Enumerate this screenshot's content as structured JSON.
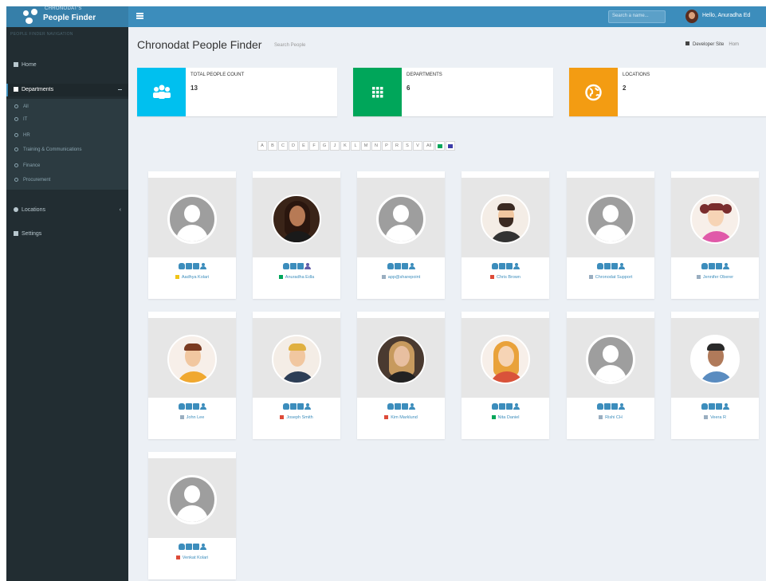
{
  "app": {
    "logo_small": "CHRONODAT'S",
    "logo_big": "People Finder"
  },
  "header": {
    "search_placeholder": "Search a name...",
    "user_name": "Hello, Anuradha Ed"
  },
  "sidebar": {
    "header": "PEOPLE FINDER NAVIGATION",
    "items": [
      {
        "label": "Home",
        "icon": "home-icon"
      },
      {
        "label": "Departments",
        "icon": "grid-icon"
      },
      {
        "label": "Locations",
        "icon": "globe-icon"
      },
      {
        "label": "Settings",
        "icon": "gears-icon"
      }
    ],
    "departments": [
      "All",
      "IT",
      "HR",
      "Training & Communications",
      "Finance",
      "Procurement"
    ]
  },
  "page": {
    "title": "Chronodat People Finder",
    "subtitle": "Search People",
    "breadcrumb": [
      "Developer Site",
      "Hom"
    ]
  },
  "stats": [
    {
      "label": "TOTAL PEOPLE COUNT",
      "value": "13",
      "color": "#00c0ef",
      "icon": "users-icon"
    },
    {
      "label": "DEPARTMENTS",
      "value": "6",
      "color": "#00a65a",
      "icon": "apps-grid-icon"
    },
    {
      "label": "LOCATIONS",
      "value": "2",
      "color": "#f39c12",
      "icon": "globe-icon"
    }
  ],
  "alphabet": [
    "A",
    "B",
    "C",
    "D",
    "E",
    "F",
    "G",
    "J",
    "K",
    "L",
    "M",
    "N",
    "P",
    "R",
    "S",
    "V",
    "All"
  ],
  "view_toggles": [
    {
      "icon": "card-view-icon",
      "color": "#00a65a"
    },
    {
      "icon": "list-view-icon",
      "color": "#3c3ca8"
    }
  ],
  "people": [
    {
      "name": "Aadhya Kolari",
      "status": "#f0c419",
      "avatar": "generic"
    },
    {
      "name": "Anuradha Edla",
      "status": "#00a65a",
      "avatar": "woman-dark"
    },
    {
      "name": "app@sharepoint",
      "status": "#9aaec0",
      "avatar": "generic"
    },
    {
      "name": "Chris Brown",
      "status": "#dd4b39",
      "avatar": "man-beard"
    },
    {
      "name": "Chronodat Support",
      "status": "#9aaec0",
      "avatar": "generic"
    },
    {
      "name": "Jennifer Oberer",
      "status": "#9aaec0",
      "avatar": "girl-cartoon"
    },
    {
      "name": "John Lee",
      "status": "#9aaec0",
      "avatar": "man-cartoon"
    },
    {
      "name": "Joseph Smith",
      "status": "#dd4b39",
      "avatar": "man-suit"
    },
    {
      "name": "Kim Marklund",
      "status": "#dd4b39",
      "avatar": "woman-blonde-photo"
    },
    {
      "name": "Nita Daniel",
      "status": "#00a65a",
      "avatar": "woman-cartoon"
    },
    {
      "name": "Rishi CH",
      "status": "#9aaec0",
      "avatar": "generic"
    },
    {
      "name": "Veera R",
      "status": "#9aaec0",
      "avatar": "man-photo"
    },
    {
      "name": "Venkat Kolari",
      "status": "#dd4b39",
      "avatar": "generic"
    }
  ]
}
